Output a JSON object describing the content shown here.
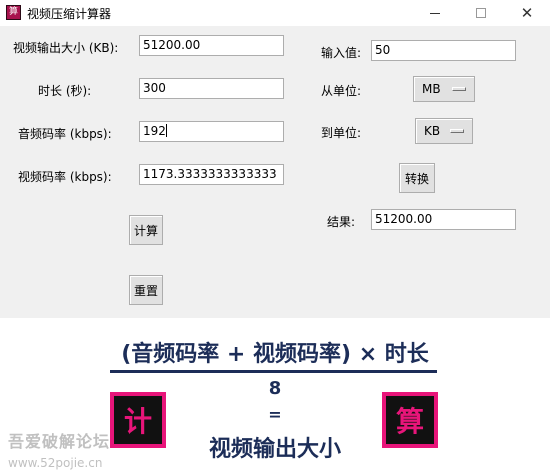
{
  "window": {
    "title": "视频压缩计算器",
    "icon_glyph": "算",
    "close_glyph": "✕"
  },
  "left_form": {
    "video_size_label": "视频输出大小 (KB):",
    "video_size_value": "51200.00",
    "duration_label": "时长 (秒):",
    "duration_value": "300",
    "audio_bitrate_label": "音频码率 (kbps):",
    "audio_bitrate_value": "192",
    "video_bitrate_label": "视频码率 (kbps):",
    "video_bitrate_value": "1173.3333333333333",
    "calc_button": "计算",
    "reset_button": "重置"
  },
  "converter": {
    "input_label": "输入值:",
    "input_value": "50",
    "from_unit_label": "从单位:",
    "from_unit_value": "MB",
    "to_unit_label": "到单位:",
    "to_unit_value": "KB",
    "convert_button": "转换",
    "result_label": "结果:",
    "result_value": "51200.00"
  },
  "formula": {
    "numerator": "(音频码率 + 视频码率) × 时长",
    "denominator": "8",
    "equals": "=",
    "result": "视频输出大小",
    "seal_left": "计",
    "seal_right": "算"
  },
  "watermark": {
    "line1": "吾爱破解论坛",
    "line2": "www.52pojie.cn"
  },
  "colors": {
    "formula_text": "#1c2d58",
    "seal_pink": "#e8157a",
    "seal_dark": "#111111"
  }
}
